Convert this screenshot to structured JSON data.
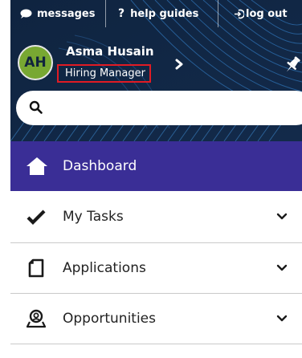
{
  "topbar": {
    "messages_label": "messages",
    "help_label": "help guides",
    "logout_label": "log out"
  },
  "user": {
    "initials": "AH",
    "name": "Asma Husain",
    "role": "Hiring Manager"
  },
  "search": {
    "placeholder": ""
  },
  "nav": {
    "items": [
      {
        "label": "Dashboard",
        "icon": "home-icon",
        "active": true
      },
      {
        "label": "My Tasks",
        "icon": "checkmark-icon",
        "expandable": true
      },
      {
        "label": "Applications",
        "icon": "document-icon",
        "expandable": true
      },
      {
        "label": "Opportunities",
        "icon": "person-badge-icon",
        "expandable": true
      }
    ]
  },
  "colors": {
    "banner": "#10233d",
    "active_nav": "#3a2e96",
    "avatar": "#78a832",
    "highlight_border": "#e01b24"
  }
}
